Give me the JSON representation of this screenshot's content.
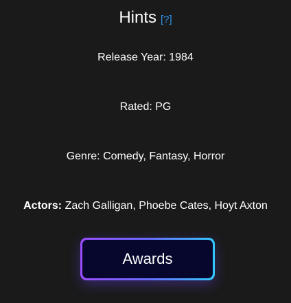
{
  "header": {
    "title": "Hints",
    "help_link": "[?]"
  },
  "hints": {
    "release_year": "Release Year: 1984",
    "rated": "Rated: PG",
    "genre": "Genre: Comedy, Fantasy, Horror",
    "actors_label": "Actors:",
    "actors_value": "Zach Galligan, Phoebe Cates, Hoyt Axton"
  },
  "awards_button": {
    "label": "Awards"
  },
  "colors": {
    "background": "#1a1a1a",
    "link": "#2f8fe6",
    "button_fill": "#07072e",
    "button_gradient_start": "#9b4dff",
    "button_gradient_end": "#33c9ff"
  }
}
